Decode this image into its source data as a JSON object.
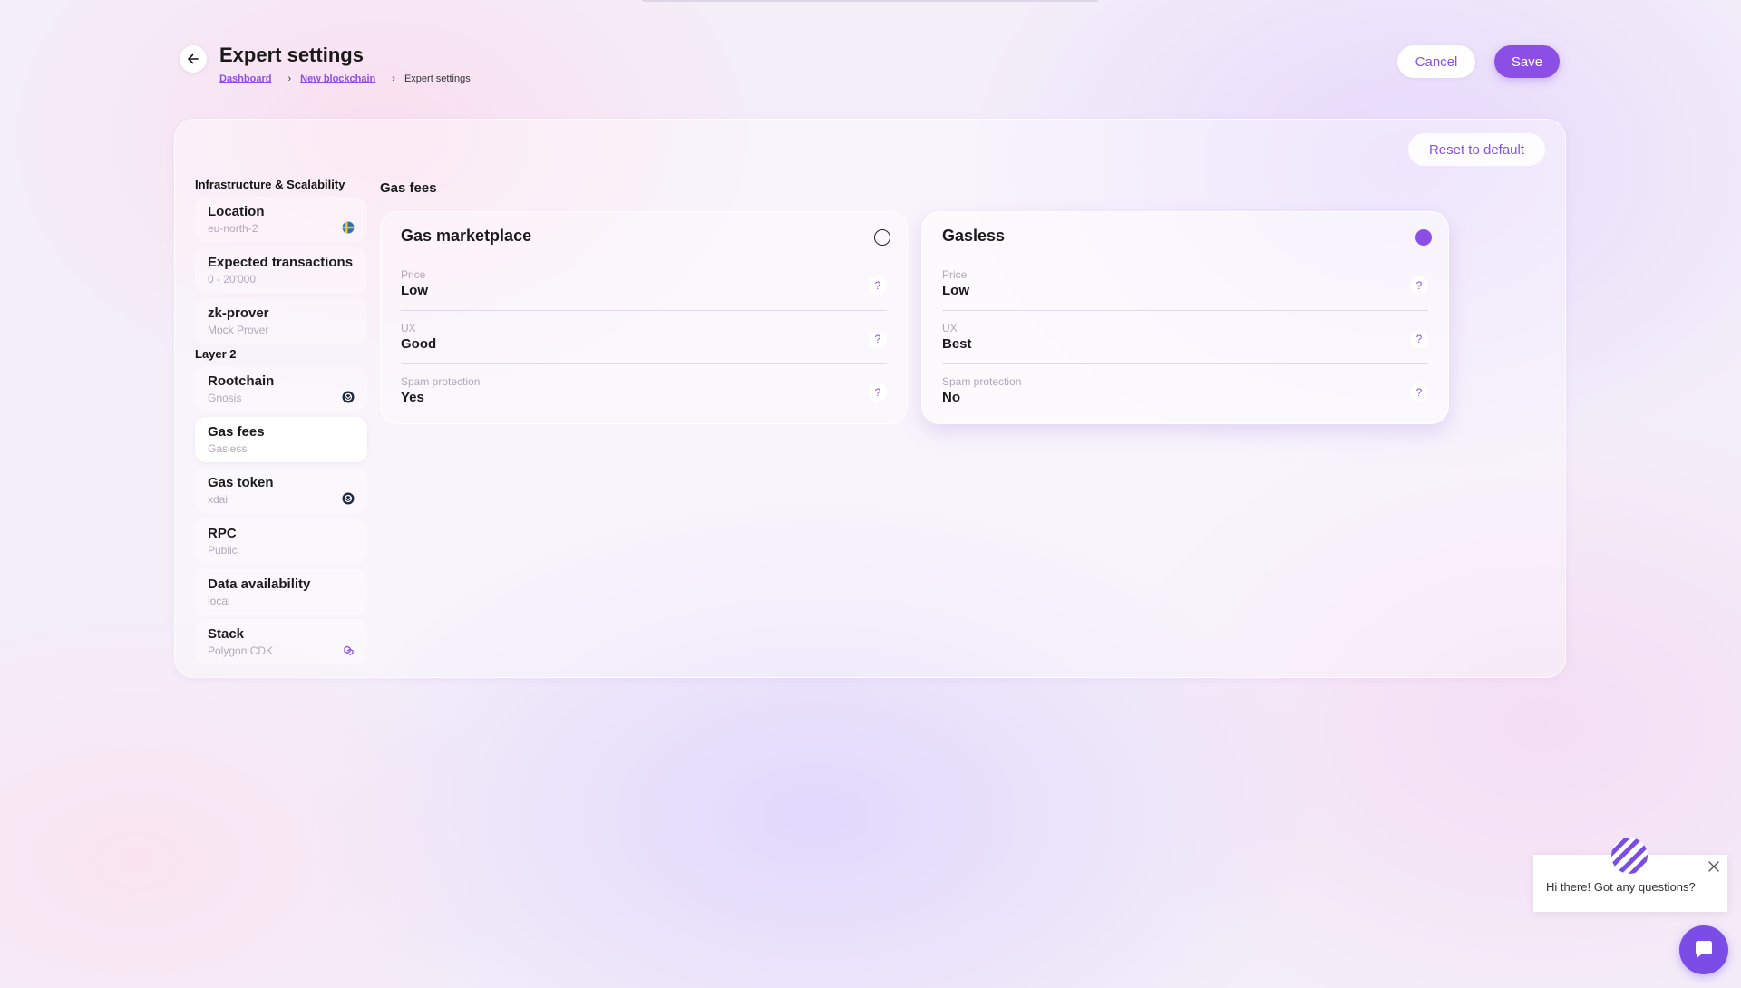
{
  "header": {
    "title": "Expert settings",
    "breadcrumb": [
      {
        "label": "Dashboard"
      },
      {
        "label": "New blockchain"
      },
      {
        "label": "Expert settings"
      }
    ],
    "cancel_label": "Cancel",
    "save_label": "Save"
  },
  "panel": {
    "reset_label": "Reset to default",
    "groups": [
      {
        "label": "Infrastructure & Scalability",
        "items": [
          {
            "label": "Location",
            "value": "eu-north-2",
            "icon": "sweden-flag-icon"
          },
          {
            "label": "Expected transactions",
            "value": "0 - 20'000"
          },
          {
            "label": "zk-prover",
            "value": "Mock Prover"
          }
        ]
      },
      {
        "label": "Layer 2",
        "items": [
          {
            "label": "Rootchain",
            "value": "Gnosis",
            "icon": "gnosis-icon"
          },
          {
            "label": "Gas fees",
            "value": "Gasless",
            "active": true
          },
          {
            "label": "Gas token",
            "value": "xdai",
            "icon": "xdai-icon"
          },
          {
            "label": "RPC",
            "value": "Public"
          },
          {
            "label": "Data availability",
            "value": "local"
          },
          {
            "label": "Stack",
            "value": "Polygon CDK",
            "icon": "polygon-icon"
          }
        ]
      }
    ],
    "section_title": "Gas fees",
    "options": [
      {
        "title": "Gas marketplace",
        "selected": false,
        "rows": [
          {
            "key": "Price",
            "value": "Low"
          },
          {
            "key": "UX",
            "value": "Good"
          },
          {
            "key": "Spam protection",
            "value": "Yes"
          }
        ]
      },
      {
        "title": "Gasless",
        "selected": true,
        "rows": [
          {
            "key": "Price",
            "value": "Low"
          },
          {
            "key": "UX",
            "value": "Best"
          },
          {
            "key": "Spam protection",
            "value": "No"
          }
        ]
      }
    ],
    "help_glyph": "?"
  },
  "chat": {
    "message": "Hi there! Got any questions?"
  },
  "colors": {
    "accent": "#8b4fe6",
    "launcher": "#7a4ee6"
  }
}
